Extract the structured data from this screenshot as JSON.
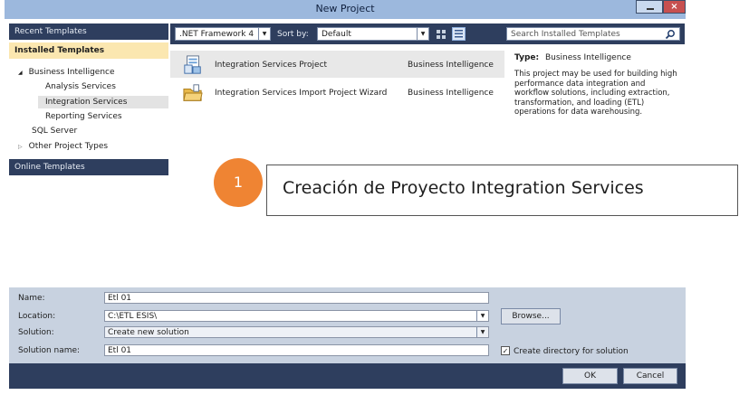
{
  "window": {
    "title": "New Project"
  },
  "left_panel": {
    "recent_header": "Recent Templates",
    "installed_header": "Installed Templates",
    "tree": [
      {
        "label": "Business Intelligence",
        "expander": "◢"
      },
      {
        "label": "Analysis Services"
      },
      {
        "label": "Integration Services",
        "selected": true
      },
      {
        "label": "Reporting Services"
      },
      {
        "label": "SQL Server"
      },
      {
        "label": "Other Project Types",
        "expander": "▷"
      }
    ],
    "online_header": "Online Templates"
  },
  "toolbar": {
    "framework": ".NET Framework 4",
    "sort_label": "Sort by:",
    "sort_value": "Default",
    "search_placeholder": "Search Installed Templates"
  },
  "templates": [
    {
      "name": "Integration Services Project",
      "type": "Business Intelligence",
      "selected": true
    },
    {
      "name": "Integration Services Import Project Wizard",
      "type": "Business Intelligence",
      "selected": false
    }
  ],
  "details": {
    "type_label": "Type:",
    "type_value": "Business Intelligence",
    "description": "This project may be used for building high performance data integration and workflow solutions, including extraction, transformation, and loading (ETL) operations for data warehousing."
  },
  "form": {
    "name_label": "Name:",
    "name_value": "Etl 01",
    "location_label": "Location:",
    "location_value": "C:\\ETL ESIS\\",
    "solution_label": "Solution:",
    "solution_value": "Create new solution",
    "solution_name_label": "Solution name:",
    "solution_name_value": "Etl 01",
    "browse_label": "Browse...",
    "create_dir_label": "Create directory for solution",
    "create_dir_checked": true
  },
  "footer": {
    "ok_label": "OK",
    "cancel_label": "Cancel"
  },
  "annotation": {
    "number": "1",
    "text": "Creación de Proyecto Integration Services"
  }
}
